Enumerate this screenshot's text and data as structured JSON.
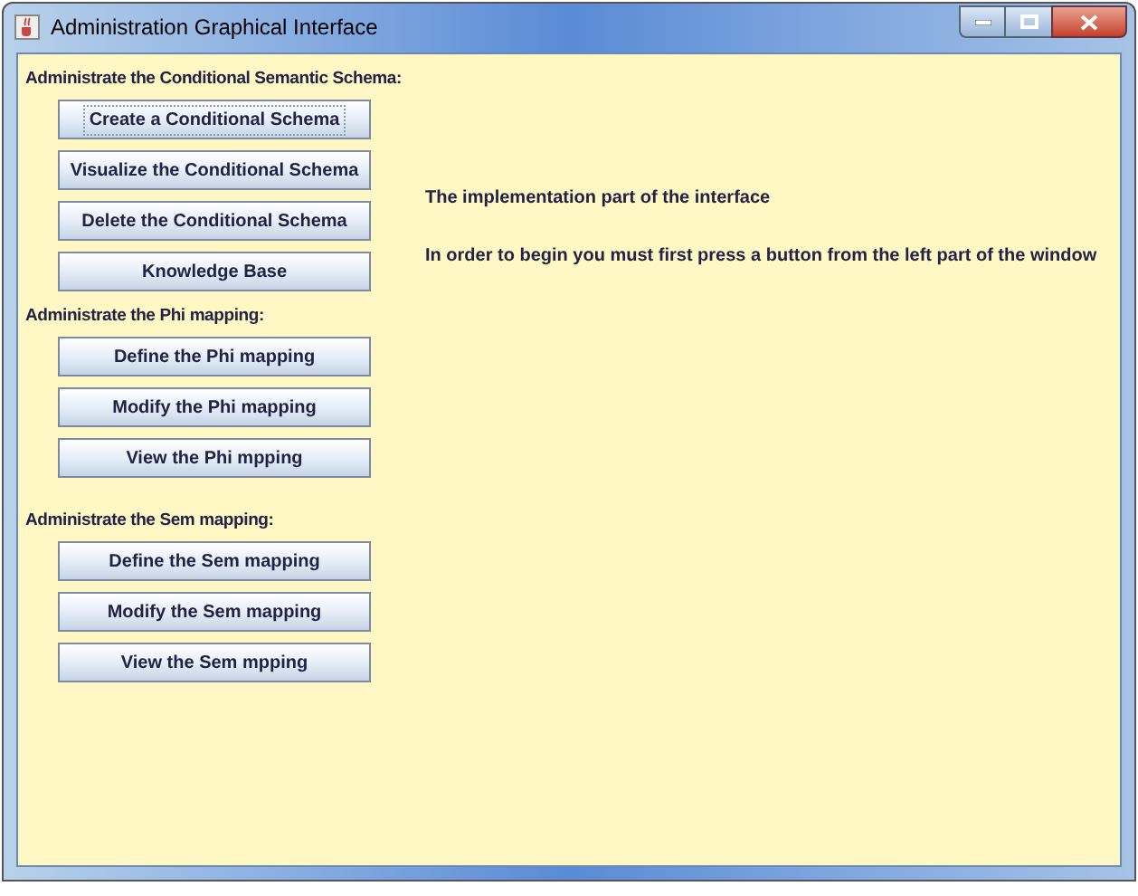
{
  "window": {
    "title": "Administration Graphical Interface"
  },
  "sections": [
    {
      "heading": "Administrate the Conditional Semantic Schema:",
      "buttons": [
        {
          "label": "Create a Conditional Schema",
          "focused": true
        },
        {
          "label": "Visualize the Conditional Schema",
          "focused": false
        },
        {
          "label": "Delete the Conditional Schema",
          "focused": false
        },
        {
          "label": "Knowledge Base",
          "focused": false
        }
      ]
    },
    {
      "heading": "Administrate the Phi mapping:",
      "buttons": [
        {
          "label": "Define the Phi mapping",
          "focused": false
        },
        {
          "label": "Modify the Phi mapping",
          "focused": false
        },
        {
          "label": "View the Phi mpping",
          "focused": false
        }
      ]
    },
    {
      "heading": "Administrate the Sem mapping:",
      "buttons": [
        {
          "label": "Define the Sem mapping",
          "focused": false
        },
        {
          "label": "Modify the Sem mapping",
          "focused": false
        },
        {
          "label": "View the Sem mpping",
          "focused": false
        }
      ]
    }
  ],
  "info": [
    "The implementation part of the interface",
    "In order to begin you must first press a button from the left part of the window"
  ]
}
